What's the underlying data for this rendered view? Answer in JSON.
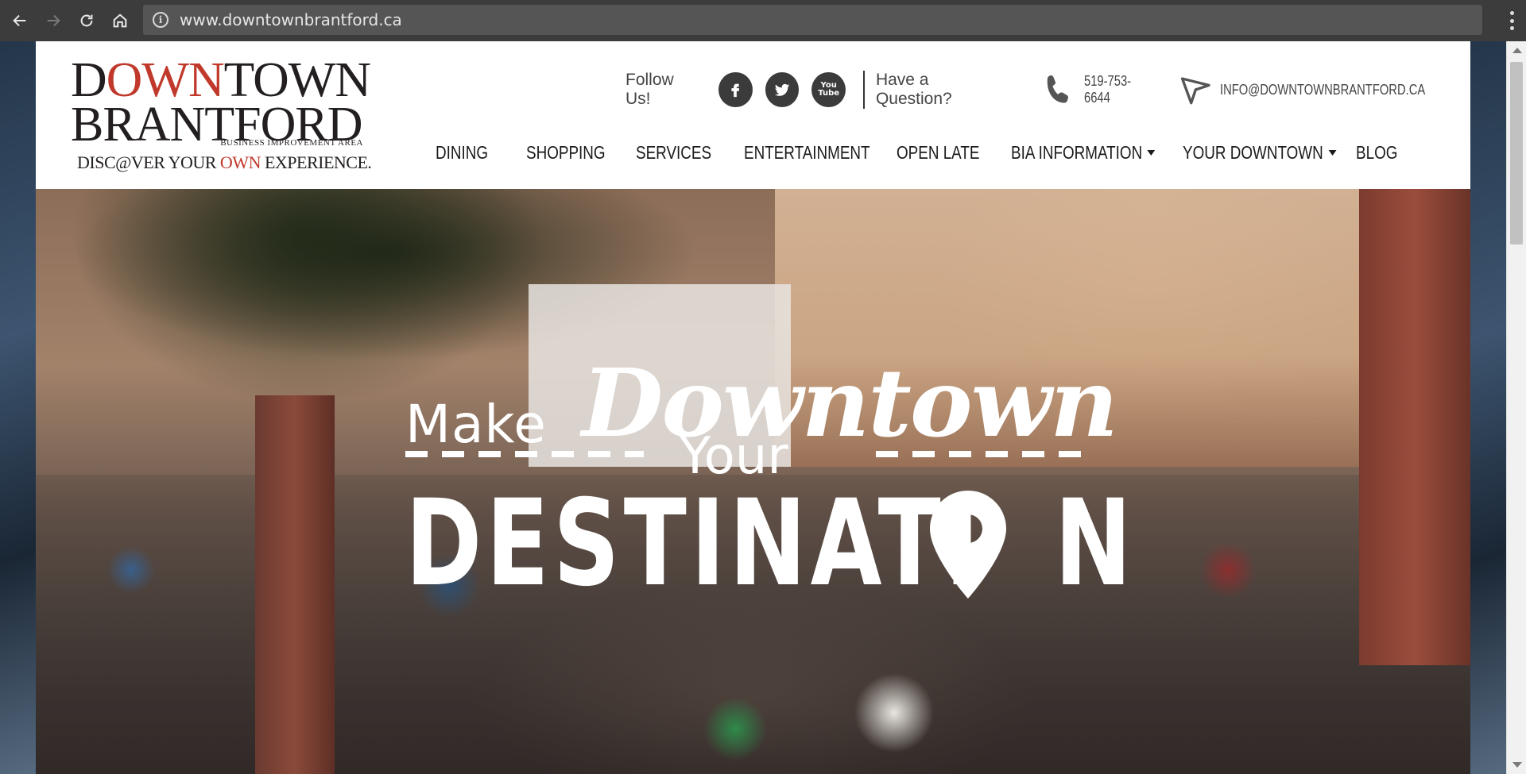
{
  "browser": {
    "url": "www.downtownbrantford.ca"
  },
  "logo": {
    "line1_a": "D",
    "line1_b": "OWN",
    "line1_c": "TOWN",
    "line2": "BRANTFORD",
    "bia": "BUSINESS IMPROVEMENT AREA",
    "tag_a": "DISC",
    "tag_b": "@",
    "tag_c": "VER YOUR ",
    "tag_own": "OWN",
    "tag_d": " EXPERIENCE."
  },
  "contact": {
    "follow_label": "Follow Us!",
    "question_label": "Have a Question?",
    "phone": "519-753-6644",
    "email": "INFO@DOWNTOWNBRANTFORD.CA",
    "youtube_top": "You",
    "youtube_bottom": "Tube"
  },
  "nav": {
    "items": [
      {
        "label": "DINING"
      },
      {
        "label": "SHOPPING"
      },
      {
        "label": "SERVICES"
      },
      {
        "label": "ENTERTAINMENT"
      },
      {
        "label": "OPEN LATE"
      },
      {
        "label": "BIA INFORMATION"
      },
      {
        "label": "YOUR DOWNTOWN"
      },
      {
        "label": "BLOG"
      }
    ]
  },
  "hero": {
    "make": "Make",
    "downtown": "Downtown",
    "your": "Your",
    "destination": "DESTINATI",
    "destination_end": "N"
  },
  "colors": {
    "brand_red": "#c0392b",
    "social_dark": "#3b3b3b"
  }
}
